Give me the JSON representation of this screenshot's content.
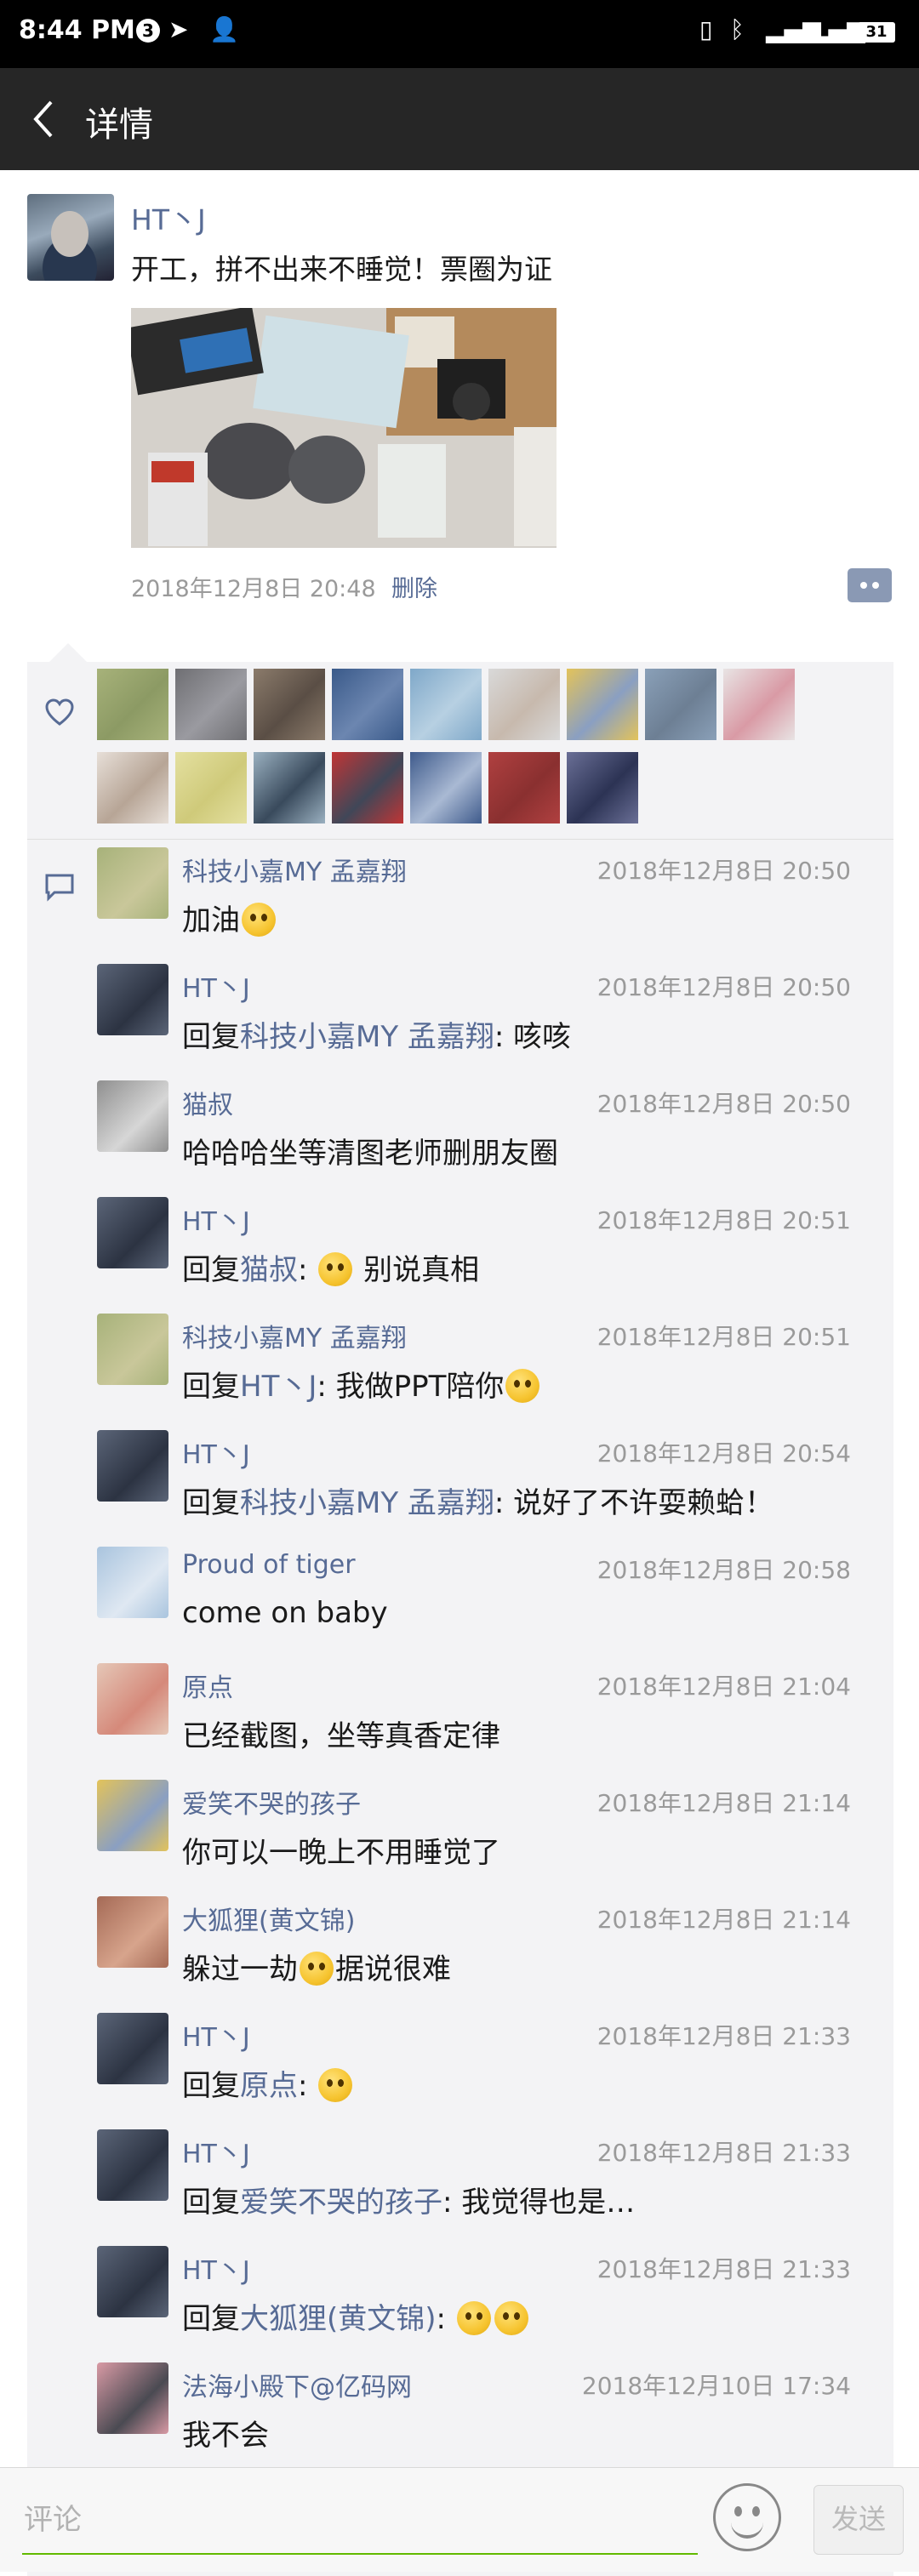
{
  "status_bar": {
    "time": "8:44 PM",
    "notif_count": "3",
    "battery": "31",
    "network": "4G"
  },
  "title_bar": {
    "title": "详情"
  },
  "post": {
    "author": "HT丶J",
    "text": "开工，拼不出来不睡觉！票圈为证",
    "timestamp": "2018年12月8日 20:48",
    "delete_label": "删除"
  },
  "likes_count_rows": 2,
  "comments": [
    {
      "name": "科技小嘉MY 孟嘉翔",
      "time": "2018年12月8日 20:50",
      "parts": [
        {
          "t": "加油"
        },
        {
          "emoji": "flushed-emoji"
        }
      ]
    },
    {
      "name": "HT丶J",
      "time": "2018年12月8日 20:50",
      "parts": [
        {
          "t": "回复"
        },
        {
          "n": "科技小嘉MY 孟嘉翔"
        },
        {
          "t": ": 咳咳"
        }
      ]
    },
    {
      "name": "猫叔",
      "time": "2018年12月8日 20:50",
      "parts": [
        {
          "t": "哈哈哈坐等清图老师删朋友圈"
        }
      ]
    },
    {
      "name": "HT丶J",
      "time": "2018年12月8日 20:51",
      "parts": [
        {
          "t": "回复"
        },
        {
          "n": "猫叔"
        },
        {
          "t": ": "
        },
        {
          "emoji": "rolling-eyes-emoji"
        },
        {
          "t": " 别说真相"
        }
      ]
    },
    {
      "name": "科技小嘉MY 孟嘉翔",
      "time": "2018年12月8日 20:51",
      "parts": [
        {
          "t": "回复"
        },
        {
          "n": "HT丶J"
        },
        {
          "t": ": 我做PPT陪你"
        },
        {
          "emoji": "tears-of-joy-emoji"
        }
      ]
    },
    {
      "name": "HT丶J",
      "time": "2018年12月8日 20:54",
      "parts": [
        {
          "t": "回复"
        },
        {
          "n": "科技小嘉MY 孟嘉翔"
        },
        {
          "t": ": 说好了不许耍赖蛤！"
        }
      ]
    },
    {
      "name": "Proud of tiger",
      "time": "2018年12月8日 20:58",
      "parts": [
        {
          "t": "come on baby"
        }
      ]
    },
    {
      "name": "原点",
      "time": "2018年12月8日 21:04",
      "parts": [
        {
          "t": "已经截图，坐等真香定律"
        }
      ]
    },
    {
      "name": "爱笑不哭的孩子",
      "time": "2018年12月8日 21:14",
      "parts": [
        {
          "t": "你可以一晚上不用睡觉了"
        }
      ]
    },
    {
      "name": "大狐狸(黄文锦)",
      "time": "2018年12月8日 21:14",
      "parts": [
        {
          "t": "躲过一劫"
        },
        {
          "emoji": "grin-emoji"
        },
        {
          "t": "据说很难"
        }
      ]
    },
    {
      "name": "HT丶J",
      "time": "2018年12月8日 21:33",
      "parts": [
        {
          "t": "回复"
        },
        {
          "n": "原点"
        },
        {
          "t": ": "
        },
        {
          "emoji": "drool-emoji"
        }
      ]
    },
    {
      "name": "HT丶J",
      "time": "2018年12月8日 21:33",
      "parts": [
        {
          "t": "回复"
        },
        {
          "n": "爱笑不哭的孩子"
        },
        {
          "t": ": 我觉得也是…"
        }
      ]
    },
    {
      "name": "HT丶J",
      "time": "2018年12月8日 21:33",
      "parts": [
        {
          "t": "回复"
        },
        {
          "n": "大狐狸(黄文锦)"
        },
        {
          "t": ": "
        },
        {
          "emoji": "tears-of-joy-emoji"
        },
        {
          "emoji": "tears-of-joy-emoji"
        }
      ]
    },
    {
      "name": "法海小殿下@亿码网",
      "time": "2018年12月10日 17:34",
      "parts": [
        {
          "t": "我不会"
        }
      ]
    }
  ],
  "input": {
    "placeholder": "评论",
    "send_label": "发送"
  },
  "colors": {
    "link": "#576b95",
    "panel": "#f3f3f5",
    "titlebar": "#262626"
  }
}
